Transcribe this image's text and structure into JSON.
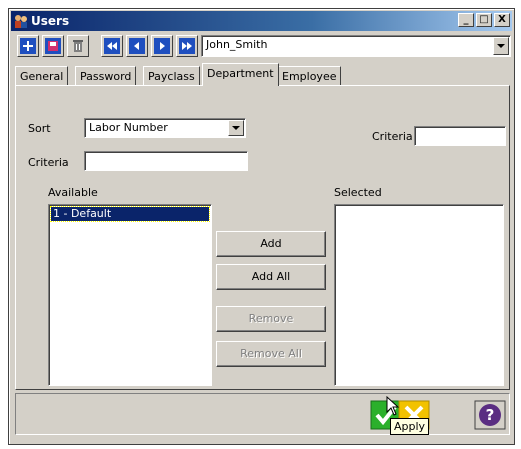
{
  "window": {
    "title": "Users",
    "controls": {
      "minimize": "_",
      "maximize": "□",
      "close": "X"
    }
  },
  "toolbar": {
    "buttons": [
      {
        "icon": "add-icon"
      },
      {
        "icon": "save-icon"
      },
      {
        "icon": "delete-icon"
      },
      {
        "icon": "first-record-icon"
      },
      {
        "icon": "previous-record-icon"
      },
      {
        "icon": "next-record-icon"
      },
      {
        "icon": "last-record-icon"
      }
    ],
    "user_select": {
      "value": "John_Smith"
    }
  },
  "tabs": [
    {
      "label": "General"
    },
    {
      "label": "Password"
    },
    {
      "label": "Payclass"
    },
    {
      "label": "Department",
      "active": true
    },
    {
      "label": "Employee"
    }
  ],
  "department": {
    "sort_label": "Sort",
    "sort_value": "Labor Number",
    "criteria_left_label": "Criteria",
    "criteria_left_value": "",
    "criteria_right_label": "Criteria",
    "criteria_right_value": "",
    "available_label": "Available",
    "available_items": [
      "1 - Default"
    ],
    "selected_label": "Selected",
    "selected_items": [],
    "buttons": {
      "add": "Add",
      "add_all": "Add All",
      "remove": "Remove",
      "remove_all": "Remove All"
    }
  },
  "footer": {
    "apply_icon": "checkmark-icon",
    "cancel_icon": "cancel-x-icon",
    "help_icon": "help-question-icon",
    "tooltip": "Apply"
  },
  "colors": {
    "window_bg": "#d4d0c8",
    "title_start": "#0a246a",
    "toolbar_blue": "#1f4fbf",
    "apply_green": "#2bb02b",
    "cancel_yellow": "#f2c200",
    "help_purple": "#5a2d82"
  }
}
